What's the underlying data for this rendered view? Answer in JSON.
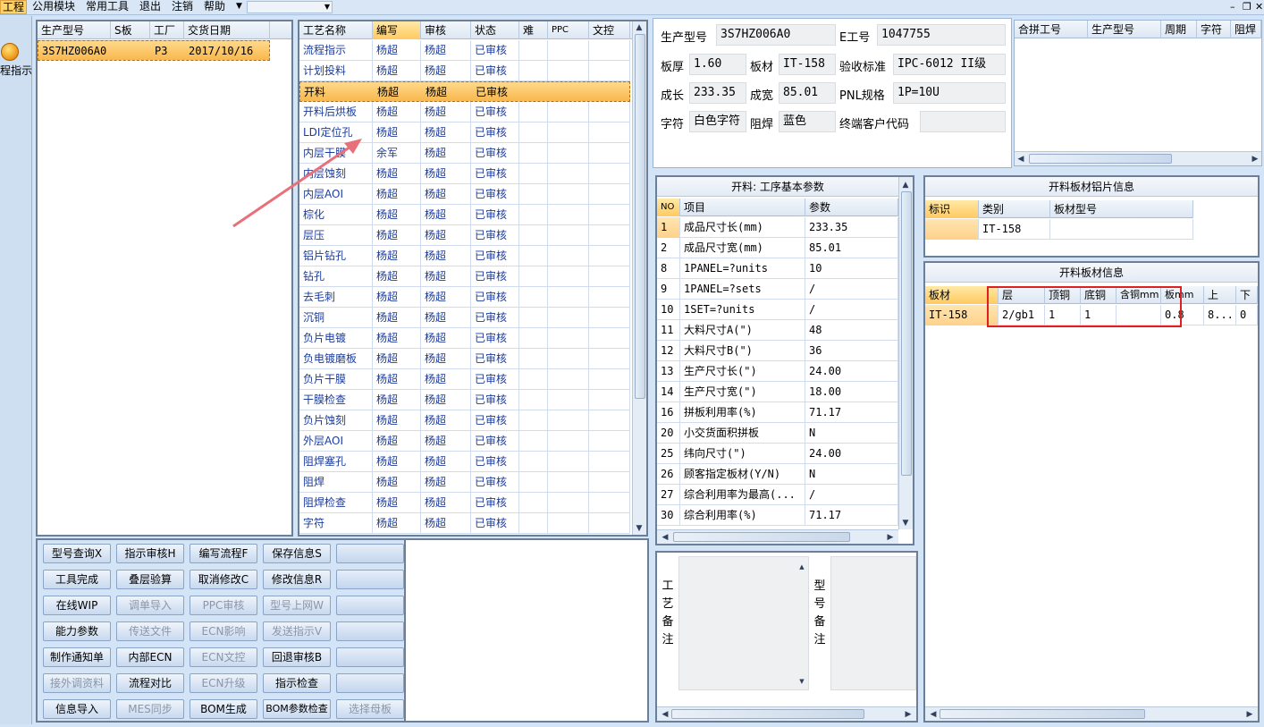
{
  "menu": [
    "工程",
    "公用模块",
    "常用工具",
    "退出",
    "注销",
    "帮助"
  ],
  "side": {
    "label": "程指示"
  },
  "orders": {
    "headers": [
      "生产型号",
      "S板",
      "工厂",
      "交货日期"
    ],
    "rows": [
      [
        "3S7HZ006A0",
        "",
        "P3",
        "2017/10/16"
      ]
    ]
  },
  "process": {
    "headers": [
      "工艺名称",
      "编写",
      "审核",
      "状态",
      "难",
      "PPC",
      "文控"
    ],
    "rows": [
      [
        "流程指示",
        "杨超",
        "杨超",
        "已审核"
      ],
      [
        "计划投料",
        "杨超",
        "杨超",
        "已审核"
      ],
      [
        "开料",
        "杨超",
        "杨超",
        "已审核"
      ],
      [
        "开料后烘板",
        "杨超",
        "杨超",
        "已审核"
      ],
      [
        "LDI定位孔",
        "杨超",
        "杨超",
        "已审核"
      ],
      [
        "内层干膜",
        "余军",
        "杨超",
        "已审核"
      ],
      [
        "内层蚀刻",
        "杨超",
        "杨超",
        "已审核"
      ],
      [
        "内层AOI",
        "杨超",
        "杨超",
        "已审核"
      ],
      [
        "棕化",
        "杨超",
        "杨超",
        "已审核"
      ],
      [
        "层压",
        "杨超",
        "杨超",
        "已审核"
      ],
      [
        "铝片钻孔",
        "杨超",
        "杨超",
        "已审核"
      ],
      [
        "钻孔",
        "杨超",
        "杨超",
        "已审核"
      ],
      [
        "去毛刺",
        "杨超",
        "杨超",
        "已审核"
      ],
      [
        "沉铜",
        "杨超",
        "杨超",
        "已审核"
      ],
      [
        "负片电镀",
        "杨超",
        "杨超",
        "已审核"
      ],
      [
        "负电镀磨板",
        "杨超",
        "杨超",
        "已审核"
      ],
      [
        "负片干膜",
        "杨超",
        "杨超",
        "已审核"
      ],
      [
        "干膜检查",
        "杨超",
        "杨超",
        "已审核"
      ],
      [
        "负片蚀刻",
        "杨超",
        "杨超",
        "已审核"
      ],
      [
        "外层AOI",
        "杨超",
        "杨超",
        "已审核"
      ],
      [
        "阻焊塞孔",
        "杨超",
        "杨超",
        "已审核"
      ],
      [
        "阻焊",
        "杨超",
        "杨超",
        "已审核"
      ],
      [
        "阻焊检查",
        "杨超",
        "杨超",
        "已审核"
      ],
      [
        "字符",
        "杨超",
        "杨超",
        "已审核"
      ]
    ]
  },
  "buttons": [
    [
      "型号查询X",
      "指示审核H",
      "编写流程F",
      "保存信息S",
      ""
    ],
    [
      "工具完成",
      "叠层验算",
      "取消修改C",
      "修改信息R",
      ""
    ],
    [
      "在线WIP",
      "调单导入",
      "PPC审核",
      "型号上网W",
      ""
    ],
    [
      "能力参数",
      "传送文件",
      "ECN影响",
      "发送指示V",
      ""
    ],
    [
      "制作通知单",
      "内部ECN",
      "ECN文控",
      "回退审核B",
      ""
    ],
    [
      "接外调资料",
      "流程对比",
      "ECN升级",
      "指示检查",
      ""
    ],
    [
      "信息导入",
      "MES同步",
      "BOM生成",
      "BOM参数检查",
      "选择母板"
    ]
  ],
  "info": {
    "l_model": "生产型号",
    "v_model": "3S7HZ006A0",
    "l_eno": "E工号",
    "v_eno": "1047755",
    "l_thick": "板厚",
    "v_thick": "1.60",
    "l_mat": "板材",
    "v_mat": "IT-158",
    "l_std": "验收标准",
    "v_std": "IPC-6012 II级",
    "l_len": "成长",
    "v_len": "233.35",
    "l_wid": "成宽",
    "v_wid": "85.01",
    "l_pnl": "PNL规格",
    "v_pnl": "1P=10U",
    "l_char": "字符",
    "v_char": "白色字符",
    "l_mask": "阻焊",
    "v_mask": "蓝色",
    "l_cust": "终端客户代码",
    "v_cust": ""
  },
  "combo": {
    "headers": [
      "合拼工号",
      "生产型号",
      "周期",
      "字符",
      "阻焊"
    ]
  },
  "params": {
    "title": "开料: 工序基本参数",
    "headers": [
      "NO",
      "项目",
      "参数"
    ],
    "rows": [
      [
        "1",
        "成品尺寸长(mm)",
        "233.35"
      ],
      [
        "2",
        "成品尺寸宽(mm)",
        "85.01"
      ],
      [
        "8",
        "1PANEL=?units",
        "10"
      ],
      [
        "9",
        "1PANEL=?sets",
        "/"
      ],
      [
        "10",
        "1SET=?units",
        "/"
      ],
      [
        "11",
        "大料尺寸A(\")",
        "48"
      ],
      [
        "12",
        "大料尺寸B(\")",
        "36"
      ],
      [
        "13",
        "生产尺寸长(\")",
        "24.00"
      ],
      [
        "14",
        "生产尺寸宽(\")",
        "18.00"
      ],
      [
        "16",
        "拼板利用率(%)",
        "71.17"
      ],
      [
        "20",
        "小交货面积拼板",
        "N"
      ],
      [
        "25",
        "纬向尺寸(\")",
        "24.00"
      ],
      [
        "26",
        "顾客指定板材(Y/N)",
        "N"
      ],
      [
        "27",
        "综合利用率为最高(...",
        "/"
      ],
      [
        "30",
        "综合利用率(%)",
        "71.17"
      ]
    ]
  },
  "foil": {
    "title": "开料板材铝片信息",
    "headers": [
      "标识",
      "类别",
      "板材型号"
    ],
    "rows": [
      [
        "",
        "IT-158",
        ""
      ]
    ]
  },
  "board": {
    "title": "开料板材信息",
    "headers": [
      "板材",
      "层",
      "顶铜",
      "底铜",
      "含铜mm",
      "板mm",
      "上",
      "下"
    ],
    "rows": [
      [
        "IT-158",
        "2/gb1",
        "1",
        "1",
        "",
        "0.8",
        "8...",
        "0"
      ]
    ]
  },
  "notes": {
    "process": "工艺备注",
    "model": "型号备注"
  },
  "colors": {
    "accent": "#ffc961",
    "annotation": "#e02020",
    "arrow": "#e8707a"
  }
}
